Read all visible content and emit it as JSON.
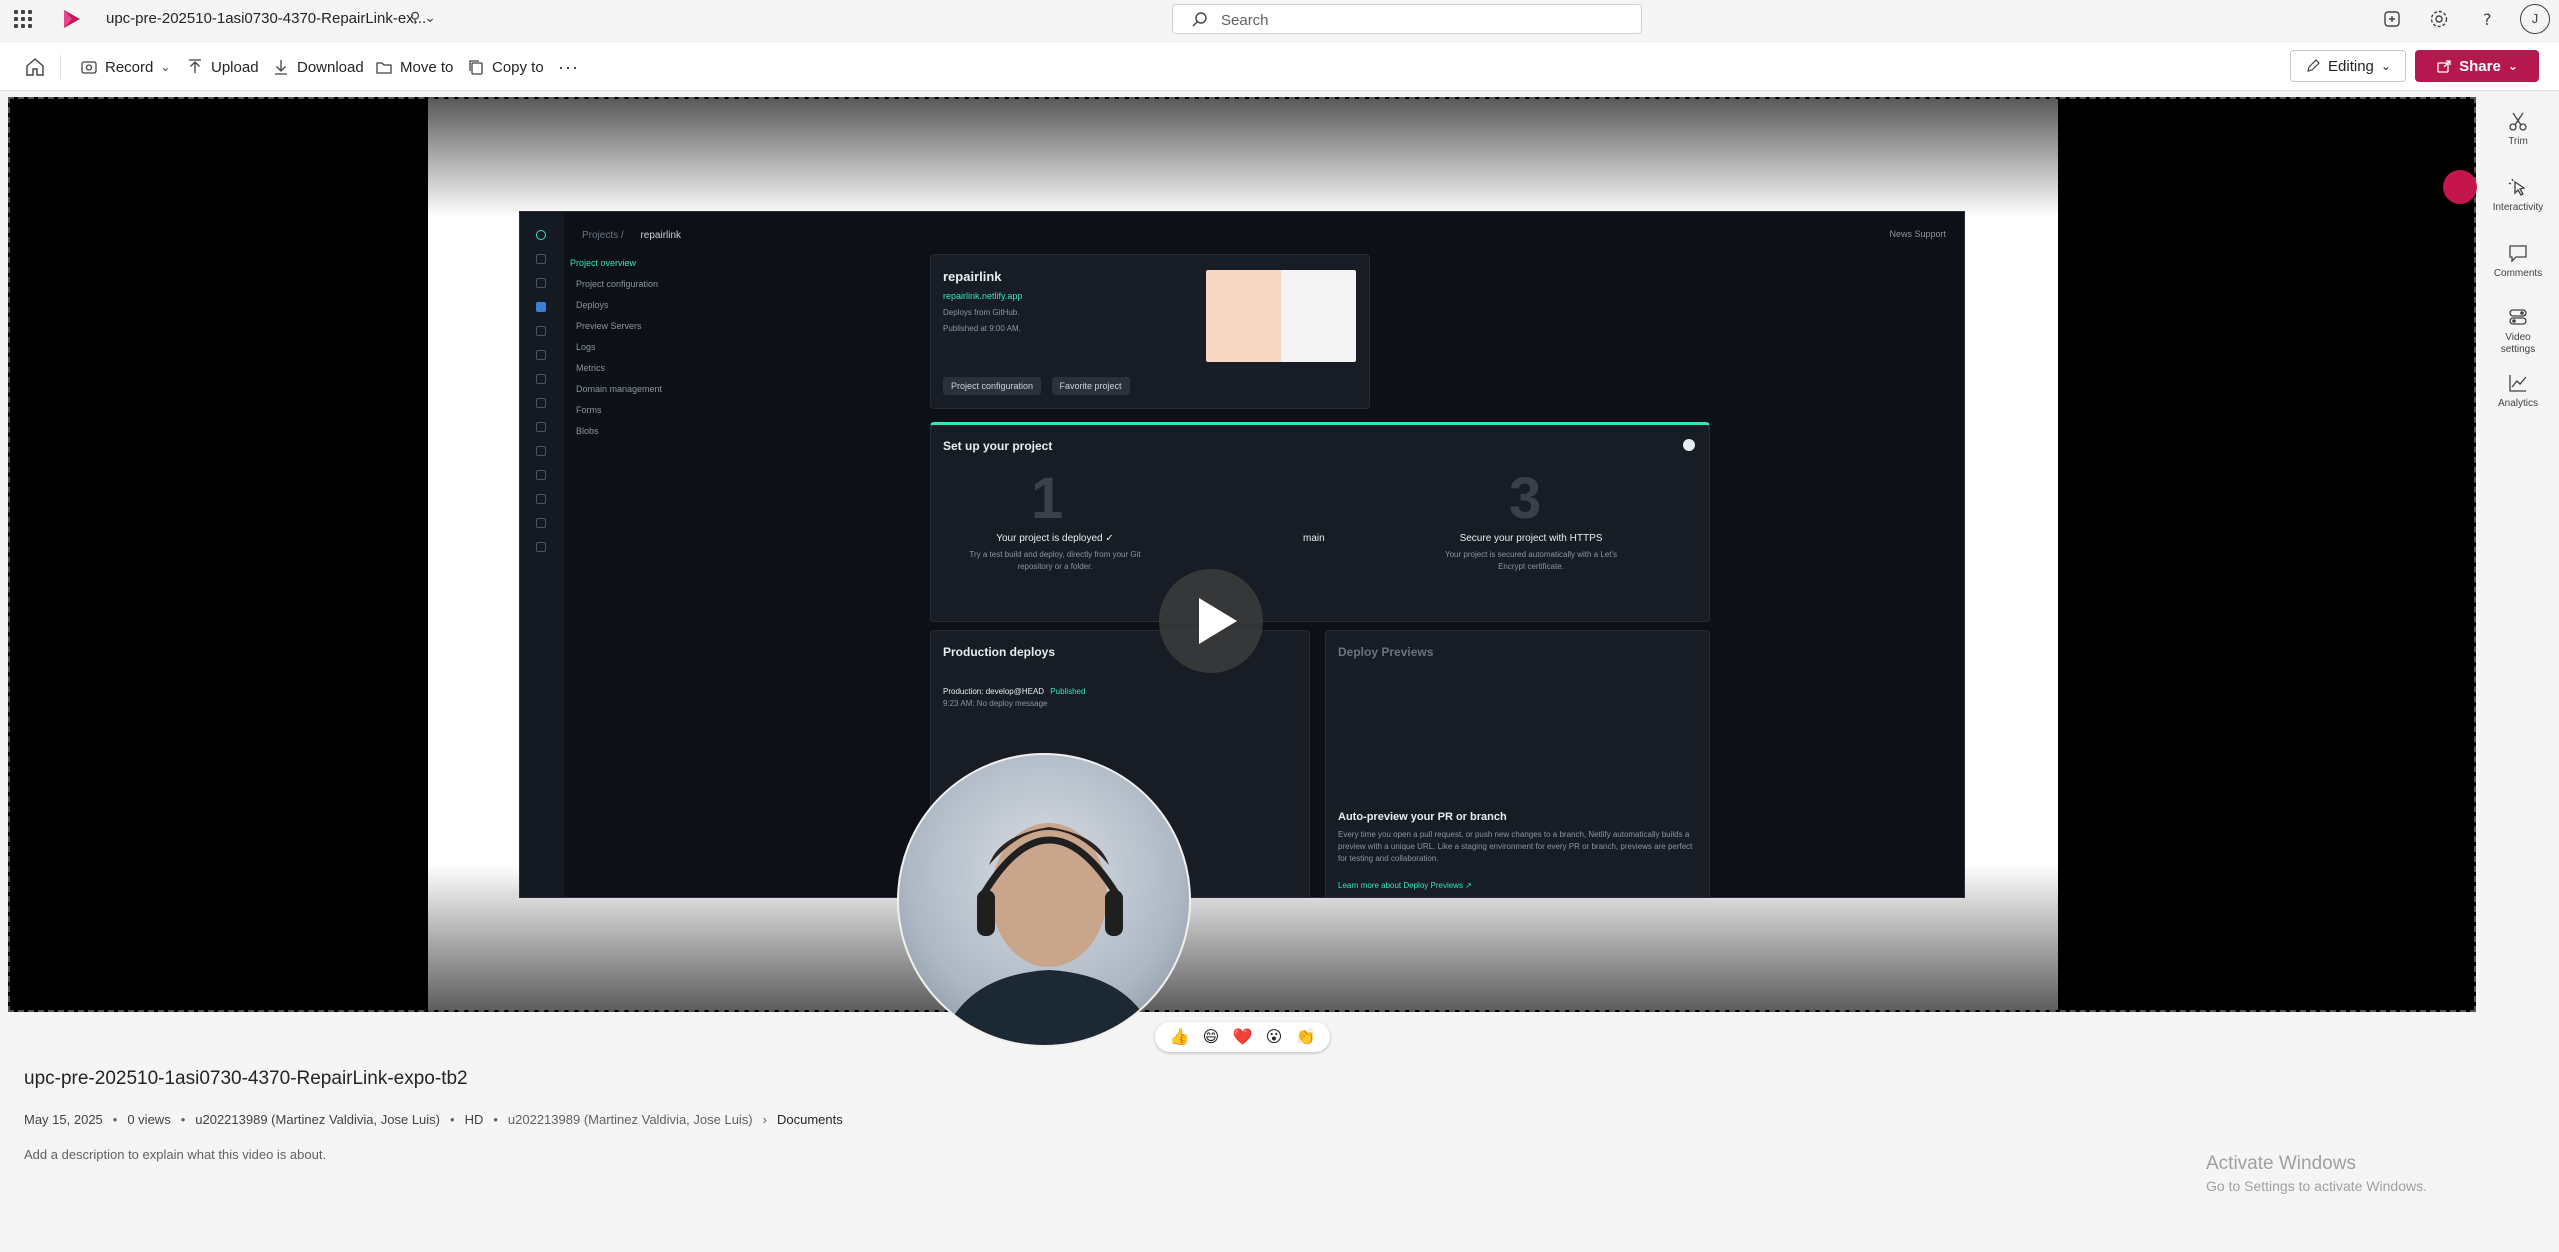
{
  "topbar": {
    "doc_title": "upc-pre-202510-1asi0730-4370-RepairLink-ex...",
    "search_placeholder": "Search",
    "avatar_initial": "J"
  },
  "commands": {
    "record": "Record",
    "upload": "Upload",
    "download": "Download",
    "move_to": "Move to",
    "copy_to": "Copy to",
    "editing": "Editing",
    "share": "Share"
  },
  "screen": {
    "breadcrumb_projects": "Projects",
    "breadcrumb_site": "repairlink",
    "top_right": "News   Support",
    "nav": [
      "Project overview",
      "Project configuration",
      "Deploys",
      "Preview Servers",
      "Logs",
      "Metrics",
      "Domain management",
      "Forms",
      "Blobs"
    ],
    "site_name": "repairlink",
    "site_url": "repairlink.netlify.app",
    "deploys_from": "Deploys from GitHub.",
    "published": "Published at 9:00 AM.",
    "btn_config": "Project configuration",
    "btn_fav": "Favorite project",
    "setup_title": "Set up your project",
    "step1_num": "1",
    "step1_title": "Your project is deployed ✓",
    "step1_desc": "Try a test build and deploy, directly from your Git repository or a folder.",
    "step2_title": "main",
    "step3_num": "3",
    "step3_title": "Secure your project with HTTPS",
    "step3_desc": "Your project is secured automatically with a Let's Encrypt certificate.",
    "prod_title": "Production deploys",
    "prod_row": "Production: develop@HEAD",
    "prod_badge": "Published",
    "prod_sub": "9:23 AM: No deploy message",
    "previews_title": "Deploy Previews",
    "auto_title": "Auto-preview your PR or branch",
    "auto_desc": "Every time you open a pull request, or push new changes to a branch, Netlify automatically builds a preview with a unique URL. Like a staging environment for every PR or branch, previews are perfect for testing and collaboration.",
    "auto_link": "Learn more about Deploy Previews ↗"
  },
  "right_rail": {
    "trim": "Trim",
    "interactivity": "Interactivity",
    "comments": "Comments",
    "video_settings": "Video settings",
    "analytics": "Analytics"
  },
  "reactions": [
    "👍",
    "😄",
    "❤️",
    "😮",
    "👏"
  ],
  "video": {
    "title": "upc-pre-202510-1asi0730-4370-RepairLink-expo-tb2",
    "date": "May 15, 2025",
    "views": "0 views",
    "owner": "u202213989 (Martinez Valdivia, Jose Luis)",
    "quality": "HD",
    "location_owner": "u202213989 (Martinez Valdivia, Jose Luis)",
    "location_folder": "Documents",
    "description_placeholder": "Add a description to explain what this video is about."
  },
  "watermark": {
    "line1": "Activate Windows",
    "line2": "Go to Settings to activate Windows."
  },
  "colors": {
    "brand": "#b4184f",
    "record_dot": "#c4164d",
    "accent_green": "#32e6b7"
  }
}
